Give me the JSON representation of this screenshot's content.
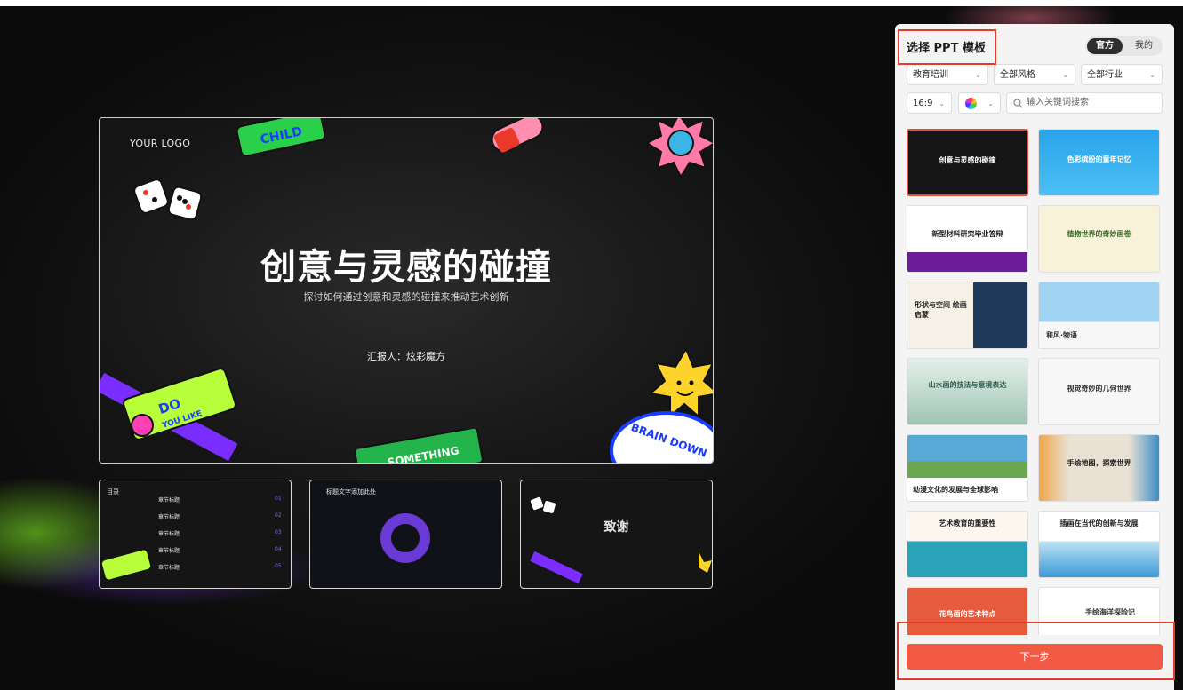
{
  "preview": {
    "logo": "YOUR LOGO",
    "title": "创意与灵感的碰撞",
    "subtitle": "探讨如何通过创意和灵感的碰撞来推动艺术创新",
    "reporter": "汇报人：炫彩魔方"
  },
  "thumbnails": [
    {
      "heading": "目录",
      "items": [
        "章节标题",
        "章节标题",
        "章节标题",
        "章节标题",
        "章节标题"
      ],
      "numbers": [
        "01",
        "02",
        "03",
        "04",
        "05"
      ]
    },
    {
      "heading": "标题文字添加此处"
    },
    {
      "heading": "致谢"
    }
  ],
  "panel": {
    "title": "选择 PPT 模板",
    "tabs": [
      "官方",
      "我的"
    ],
    "filters": {
      "category": "教育培训",
      "style": "全部风格",
      "industry": "全部行业",
      "ratio": "16:9"
    },
    "search_placeholder": "输入关键词搜索",
    "templates": [
      {
        "title": "创意与灵感的碰撞",
        "theme": "#161616",
        "color": "#ffffff"
      },
      {
        "title": "色彩缤纷的童年记忆",
        "theme": "#2aa3ea",
        "color": "#ffffff"
      },
      {
        "title": "新型材料研究毕业答辩",
        "theme": "#ffffff",
        "color": "#222222"
      },
      {
        "title": "植物世界的奇妙画卷",
        "theme": "#f7f2d8",
        "color": "#3a6a2a"
      },
      {
        "title": "形状与空间 绘画启蒙",
        "theme": "#f6f1e7",
        "color": "#222222"
      },
      {
        "title": "和风·物语",
        "theme": "#9fd3f1",
        "color": "#333333"
      },
      {
        "title": "山水画的技法与意境表达",
        "theme": "#cfe3da",
        "color": "#2f5f4f"
      },
      {
        "title": "视觉奇妙的几何世界",
        "theme": "#f7f7f7",
        "color": "#333333"
      },
      {
        "title": "动漫文化的发展与全球影响",
        "theme": "#58a9d8",
        "color": "#222222"
      },
      {
        "title": "手绘地图，探索世界",
        "theme": "#e9e1d3",
        "color": "#222222"
      },
      {
        "title": "艺术教育的重要性",
        "theme": "#fbf6ee",
        "color": "#222222"
      },
      {
        "title": "插画在当代的创新与发展",
        "theme": "#ffffff",
        "color": "#222222"
      },
      {
        "title": "花鸟画的艺术特点",
        "theme": "#e65b3b",
        "color": "#ffffff"
      },
      {
        "title": "手绘海洋探险记",
        "theme": "#ffffff",
        "color": "#333333"
      }
    ],
    "next_label": "下一步"
  }
}
